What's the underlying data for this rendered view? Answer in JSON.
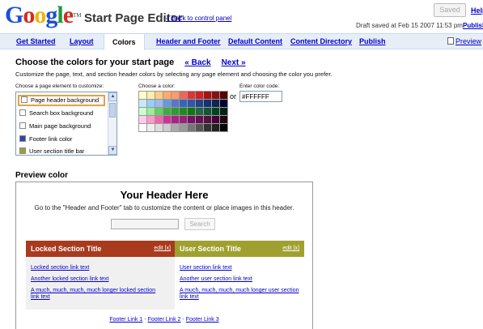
{
  "header": {
    "logo": "Google",
    "logo_tm": "TM",
    "title": "Start Page Editor",
    "back_link": "« Back to control panel",
    "saved_button": "Saved",
    "help_link": "Help",
    "draft_status": "Draft saved at Feb 15 2007 11:53 pm",
    "publish_link": "Publish"
  },
  "tabs": [
    {
      "label": "Get Started"
    },
    {
      "label": "Layout"
    },
    {
      "label": "Colors",
      "active": true
    },
    {
      "label": "Header and Footer"
    },
    {
      "label": "Default Content"
    },
    {
      "label": "Content Directory"
    },
    {
      "label": "Publish"
    }
  ],
  "preview_tab": "Preview",
  "section": {
    "title": "Choose the colors for your start page",
    "back": "« Back",
    "next": "Next »",
    "description": "Customize the page, text, and section header colors by selecting any page element and choosing the color you prefer.",
    "element_label": "Choose a page element to customize:",
    "color_label": "Choose a color:",
    "code_label": "Enter color code:",
    "or_text": "or",
    "color_code": "#FFFFFF"
  },
  "elements": [
    {
      "label": "Page header background",
      "swatch": "#ffffff",
      "selected": true
    },
    {
      "label": "Search box background",
      "swatch": "#ffffff"
    },
    {
      "label": "Main page background",
      "swatch": "#ffffff"
    },
    {
      "label": "Footer link color",
      "swatch": "#2a44b8"
    },
    {
      "label": "User section title bar",
      "swatch": "#a0a030"
    }
  ],
  "palette": [
    "#ffffcc",
    "#ffeeaa",
    "#ffcc88",
    "#ffaa66",
    "#ff9966",
    "#ee6655",
    "#dd3333",
    "#cc2222",
    "#aa1111",
    "#881111",
    "#550000",
    "#cce6ff",
    "#99ccff",
    "#99bbee",
    "#6699dd",
    "#5577cc",
    "#3366bb",
    "#3355aa",
    "#224488",
    "#113377",
    "#112255",
    "#000033",
    "#ccffcc",
    "#99ee99",
    "#66cc66",
    "#44aa44",
    "#339933",
    "#228822",
    "#117711",
    "#226644",
    "#115533",
    "#004422",
    "#002211",
    "#ffccee",
    "#ff99cc",
    "#ee66aa",
    "#cc3399",
    "#aa2288",
    "#992277",
    "#771166",
    "#661155",
    "#551144",
    "#440033",
    "#220011",
    "#ffffff",
    "#eeeeee",
    "#dddddd",
    "#cccccc",
    "#aaaaaa",
    "#999999",
    "#777777",
    "#555555",
    "#333333",
    "#222222",
    "#000000"
  ],
  "preview": {
    "heading": "Preview color",
    "header_title": "Your Header Here",
    "header_sub": "Go to the \"Header and Footer\" tab to customize the content or place images in this header.",
    "search_button": "Search",
    "locked": {
      "title": "Locked Section Title",
      "edit": "edit [x]",
      "bar_color": "#a83b1e",
      "links": [
        "Locked section link text",
        "Another locked section link text",
        "A much, much, much, much longer locked section link text"
      ]
    },
    "user": {
      "title": "User Section Title",
      "edit": "edit [x]",
      "bar_color": "#a0a030",
      "links": [
        "User section link text",
        "Another user section link text",
        "A much, much, much, much longer user section link text"
      ]
    },
    "footer_links": [
      "Footer Link 1",
      "Footer Link 2",
      "Footer Link 3"
    ],
    "footer_sep": "-"
  }
}
